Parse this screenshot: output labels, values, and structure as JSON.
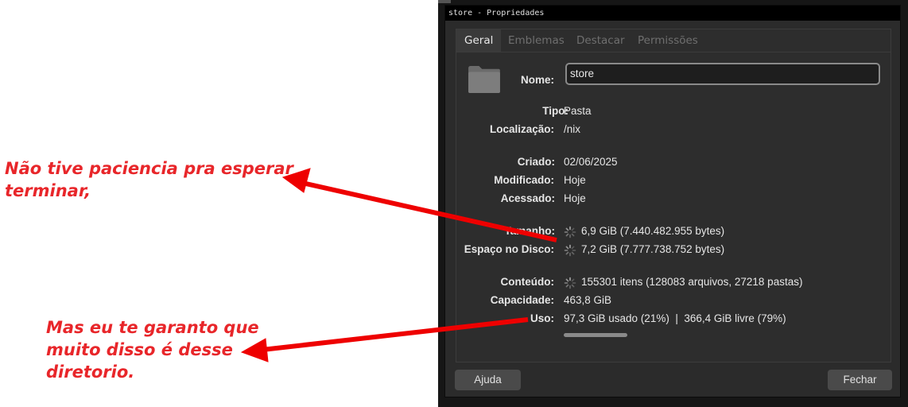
{
  "window": {
    "title": "store - Propriedades"
  },
  "tabs": [
    "Geral",
    "Emblemas",
    "Destacar",
    "Permissões"
  ],
  "fields": {
    "name": {
      "label": "Nome:",
      "value": "store"
    },
    "tipo": {
      "label": "Tipo:",
      "value": "Pasta"
    },
    "localizacao": {
      "label": "Localização:",
      "value": "/nix"
    },
    "criado": {
      "label": "Criado:",
      "value": "02/06/2025"
    },
    "modificado": {
      "label": "Modificado:",
      "value": "Hoje"
    },
    "acessado": {
      "label": "Acessado:",
      "value": "Hoje"
    },
    "tamanho": {
      "label": "Tamanho:",
      "value": "6,9 GiB (7.440.482.955 bytes)"
    },
    "espaco": {
      "label": "Espaço no Disco:",
      "value": "7,2 GiB (7.777.738.752 bytes)"
    },
    "conteudo": {
      "label": "Conteúdo:",
      "value": "155301 itens (128083 arquivos, 27218 pastas)"
    },
    "capacidade": {
      "label": "Capacidade:",
      "value": "463,8 GiB"
    },
    "uso": {
      "label": "Uso:",
      "value": "97,3 GiB usado (21%)  |  366,4 GiB livre (79%)",
      "used_fraction": 0.21
    }
  },
  "buttons": {
    "help": "Ajuda",
    "close": "Fechar"
  },
  "annotations": {
    "top_line1": "Não tive paciencia pra esperar",
    "top_line2": "terminar,",
    "bottom_line1": "Mas eu te garanto que",
    "bottom_line2": "muito disso é desse",
    "bottom_line3": "diretorio."
  },
  "colors": {
    "annotation": "#e8262a",
    "arrow": "#ee0000",
    "window_bg": "#2b2b2b",
    "titlebar": "#000000"
  },
  "icons": [
    "folder-icon",
    "spinner-icon"
  ]
}
